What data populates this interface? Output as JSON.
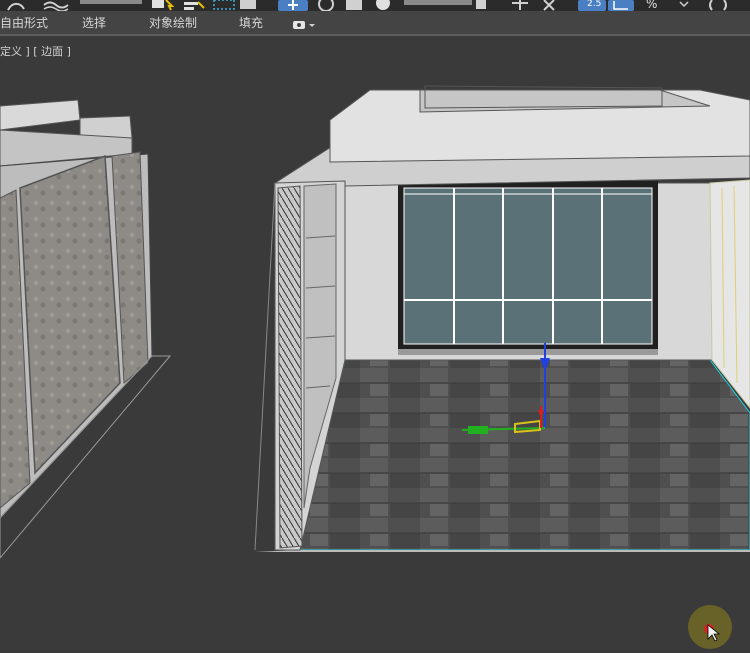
{
  "ribbon": {
    "tabs": [
      {
        "label": "自由形式"
      },
      {
        "label": "选择"
      },
      {
        "label": "对象绘制"
      },
      {
        "label": "填充"
      }
    ]
  },
  "toolbar": {
    "snap_label": "2.5",
    "percent_label": "%"
  },
  "viewport": {
    "label_prefix": "定义 ]",
    "label_view": "[ 边面 ]"
  },
  "colors": {
    "ui_dark": "#2b2b2b",
    "ribbon": "#444444",
    "viewport_bg": "#3a3a3a",
    "window_glass": "#5a7178",
    "floor": "#555555",
    "wall": "#d8d8d8",
    "gizmo_x": "#d42020",
    "gizmo_y": "#20b020",
    "gizmo_z": "#2040e0",
    "gizmo_plane": "#d6c21a",
    "active_button": "#4a7fc4"
  },
  "icons": [
    "scale-icon",
    "arrow-cursor-icon",
    "select-region-icon",
    "move-icon",
    "rotate-icon",
    "snap-toggle-icon",
    "angle-snap-icon",
    "percent-snap-icon",
    "eye-icon",
    "chevron-down-icon"
  ]
}
